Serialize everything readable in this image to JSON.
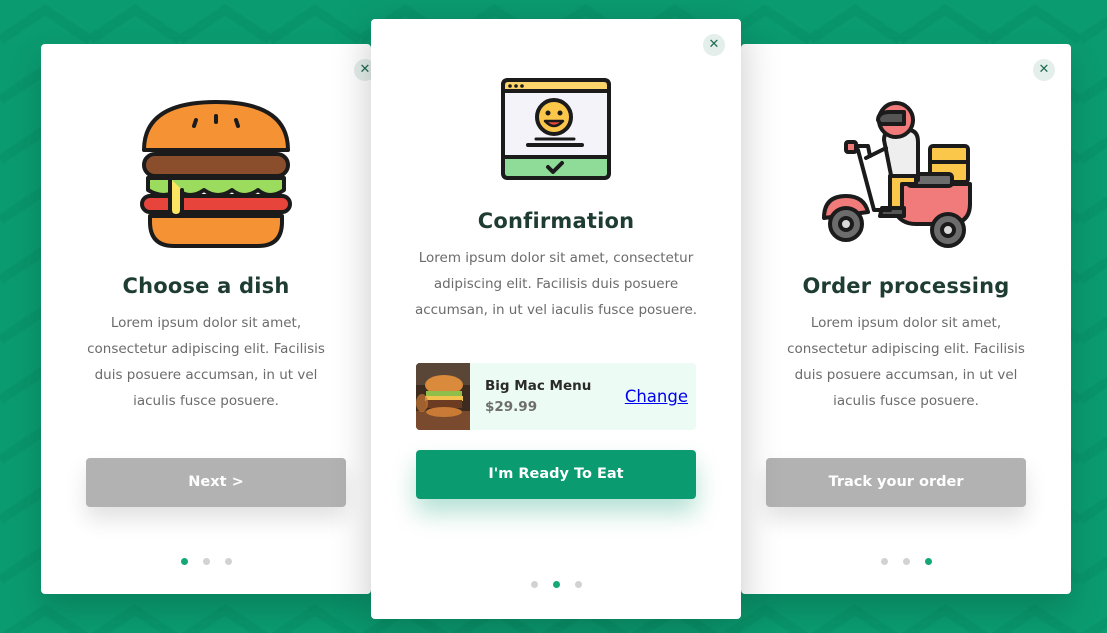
{
  "colors": {
    "background": "#0b9b70",
    "accent": "#0b9b70",
    "disabled_button": "#b2b2b2",
    "title_text": "#1f3c33",
    "body_text": "#6b6b6b",
    "dot_active": "#14a777",
    "dot_inactive": "#d2d2d2",
    "product_bg": "#ecfbf4",
    "link": "#0000ee"
  },
  "cards": {
    "left": {
      "close_glyph": "✕",
      "icon": "burger-icon",
      "title": "Choose a dish",
      "text": "Lorem ipsum dolor sit amet, consectetur adipiscing elit. Facilisis duis posuere accumsan, in ut vel iaculis fusce posuere.",
      "button_label": "Next >",
      "active_dot": 0
    },
    "center": {
      "close_glyph": "✕",
      "icon": "browser-confirmation-icon",
      "title": "Confirmation",
      "text": "Lorem ipsum dolor sit amet, consectetur adipiscing elit. Facilisis duis posuere accumsan, in ut vel iaculis fusce posuere.",
      "product": {
        "thumbnail": "burger-photo",
        "name": "Big Mac Menu",
        "price": "$29.99",
        "change_label": "Change"
      },
      "button_label": "I'm Ready To Eat",
      "active_dot": 1
    },
    "right": {
      "close_glyph": "✕",
      "icon": "delivery-scooter-icon",
      "title": "Order processing",
      "text": "Lorem ipsum dolor sit amet, consectetur adipiscing elit. Facilisis duis posuere accumsan, in ut vel iaculis fusce posuere.",
      "button_label": "Track your order",
      "active_dot": 2
    }
  }
}
